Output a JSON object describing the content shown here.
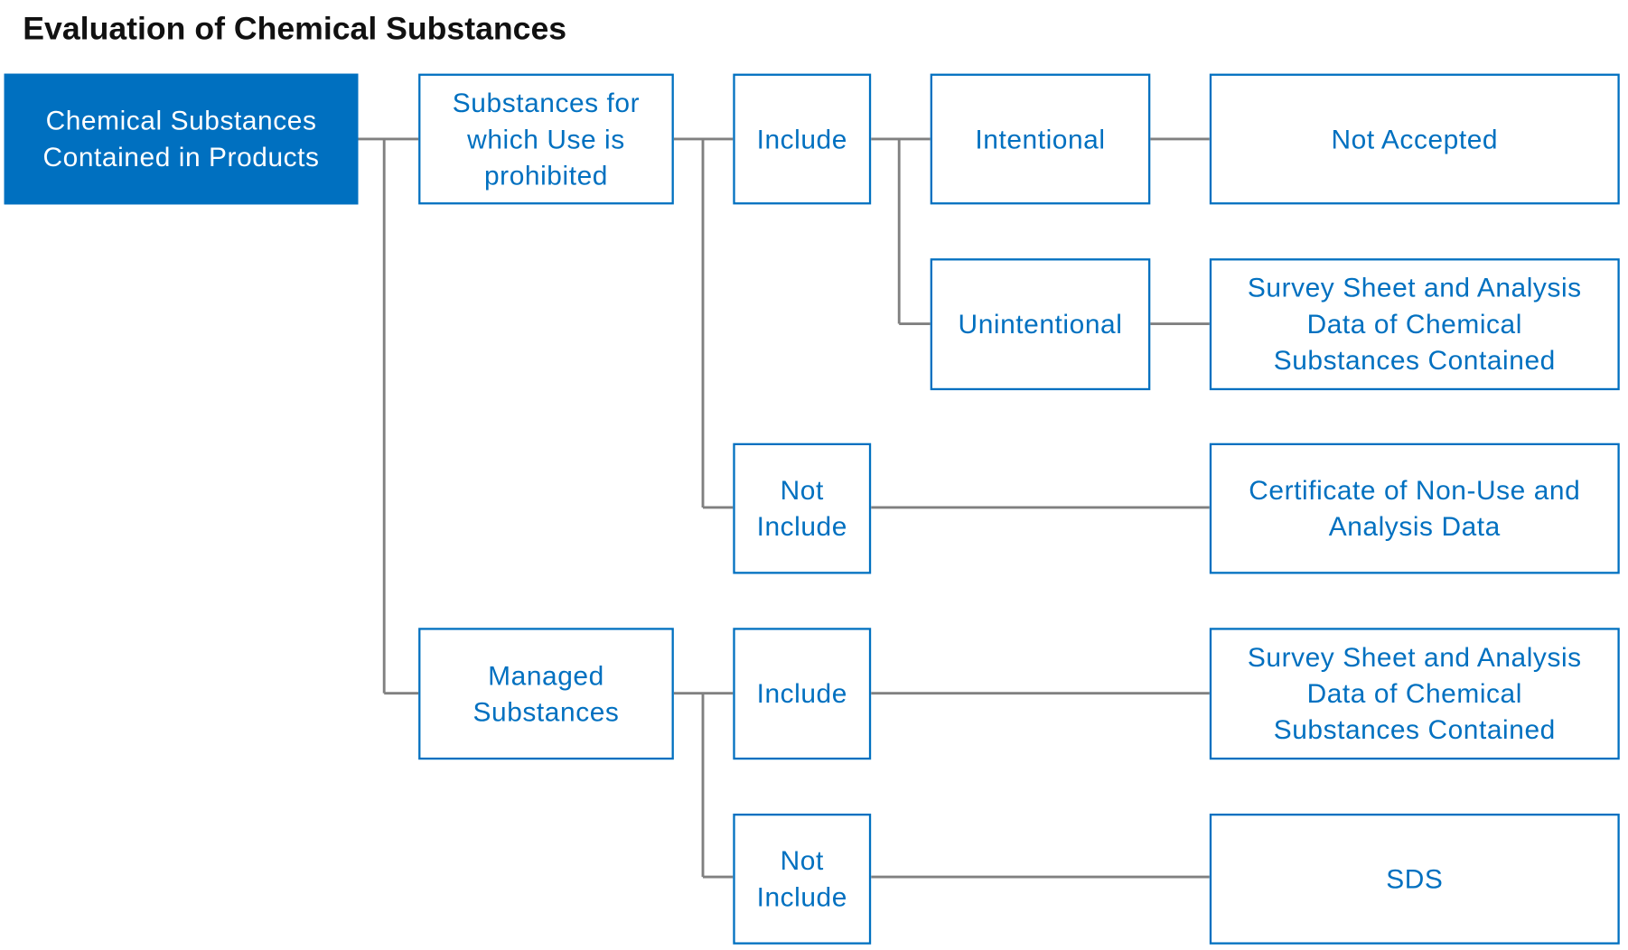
{
  "title": "Evaluation of Chemical Substances",
  "colors": {
    "accent": "#0070c0",
    "connector": "#808080"
  },
  "nodes": {
    "root": "Chemical Substances\nContained in Products",
    "prohibited": "Substances for\nwhich Use is\nprohibited",
    "managed": "Managed\nSubstances",
    "prohibited_include": "Include",
    "prohibited_not_include": "Not\nInclude",
    "managed_include": "Include",
    "managed_not_include": "Not\nInclude",
    "intentional": "Intentional",
    "unintentional": "Unintentional",
    "result_not_accepted": "Not Accepted",
    "result_survey_unintentional": "Survey Sheet and Analysis\nData of Chemical\nSubstances Contained",
    "result_certificate": "Certificate of Non-Use and\nAnalysis Data",
    "result_survey_managed": "Survey Sheet and Analysis\nData of Chemical\nSubstances Contained",
    "result_sds": "SDS"
  }
}
